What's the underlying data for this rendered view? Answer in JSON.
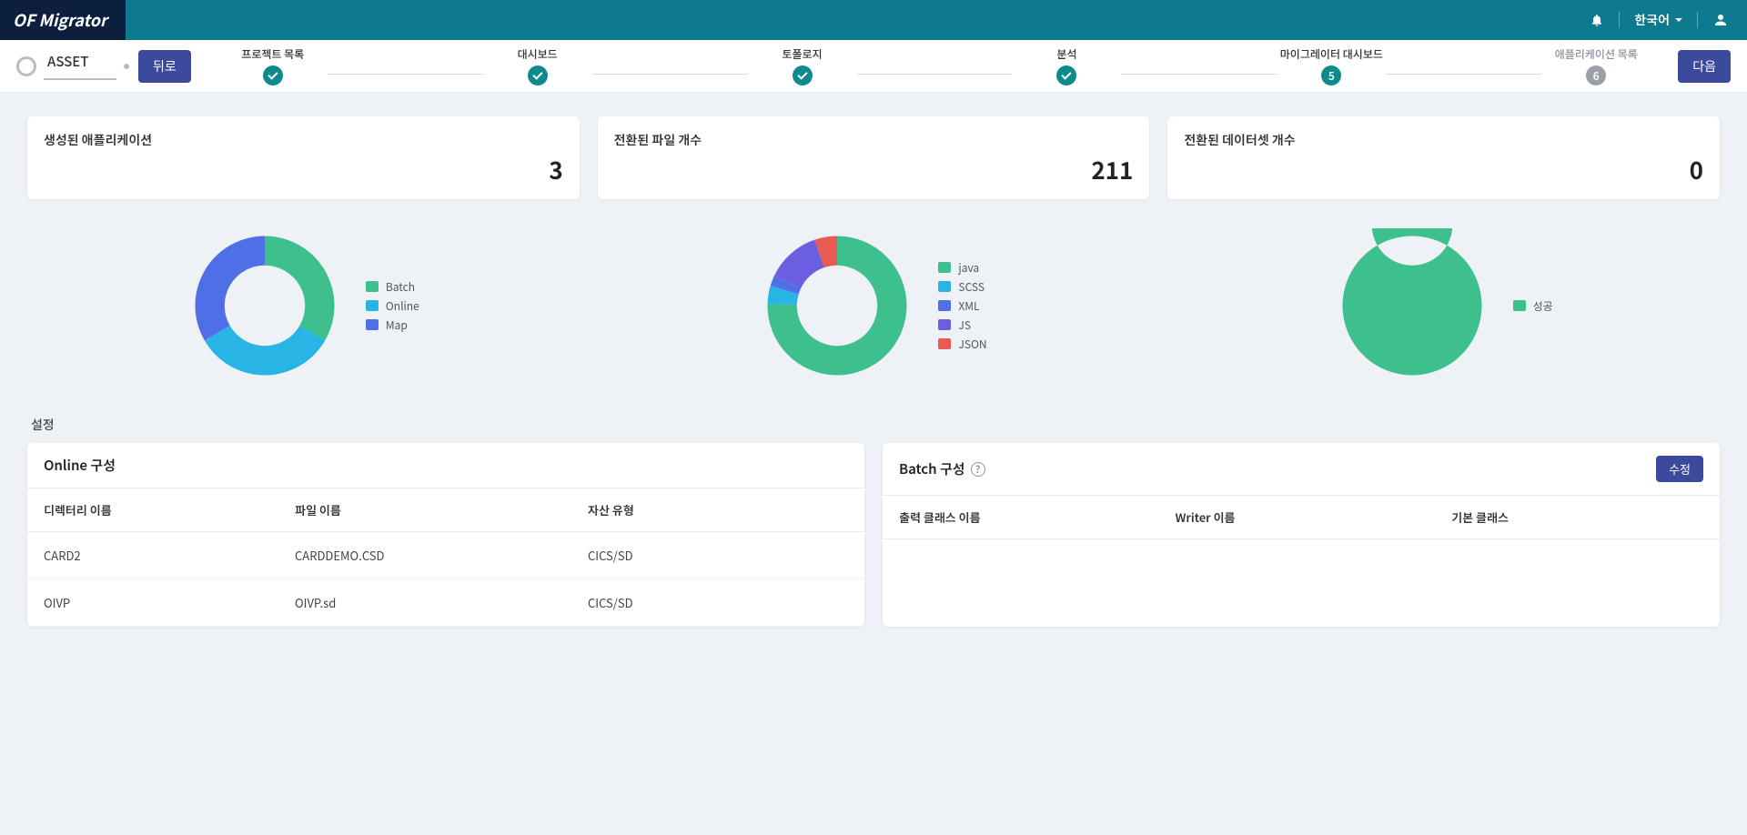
{
  "brand": "OF Migrator",
  "header": {
    "language": "한국어"
  },
  "subheader": {
    "asset_label": "ASSET",
    "back_label": "뒤로",
    "next_label": "다음"
  },
  "stepper": {
    "steps": [
      {
        "label": "프로젝트 목록",
        "state": "done"
      },
      {
        "label": "대시보드",
        "state": "done"
      },
      {
        "label": "토폴로지",
        "state": "done"
      },
      {
        "label": "분석",
        "state": "done"
      },
      {
        "label": "마이그레이터 대시보드",
        "state": "current",
        "num": "5"
      },
      {
        "label": "애플리케이션 목록",
        "state": "pending",
        "num": "6"
      }
    ]
  },
  "stats": {
    "apps": {
      "title": "생성된 애플리케이션",
      "value": "3"
    },
    "files": {
      "title": "전환된 파일 개수",
      "value": "211"
    },
    "datasets": {
      "title": "전환된 데이터셋 개수",
      "value": "0"
    }
  },
  "chart_data": [
    {
      "type": "pie",
      "title": "생성된 애플리케이션",
      "series": [
        {
          "name": "Batch",
          "value": 1,
          "color": "#3dbf8e"
        },
        {
          "name": "Online",
          "value": 1,
          "color": "#29b4e6"
        },
        {
          "name": "Map",
          "value": 1,
          "color": "#4f6fe6"
        }
      ]
    },
    {
      "type": "pie",
      "title": "전환된 파일 개수",
      "series": [
        {
          "name": "java",
          "value": 159,
          "color": "#3dbf8e"
        },
        {
          "name": "SCSS",
          "value": 9,
          "color": "#29b4e6"
        },
        {
          "name": "XML",
          "value": 5,
          "color": "#4f6fe6"
        },
        {
          "name": "JS",
          "value": 27,
          "color": "#6a5fe0"
        },
        {
          "name": "JSON",
          "value": 11,
          "color": "#ea5a55"
        }
      ]
    },
    {
      "type": "pie",
      "title": "전환된 데이터셋 개수",
      "series": [
        {
          "name": "성공",
          "value": 1,
          "color": "#3dbf8e"
        }
      ]
    }
  ],
  "settings_label": "설정",
  "online_panel": {
    "title": "Online 구성",
    "headers": {
      "dir": "디렉터리 이름",
      "file": "파일 이름",
      "asset_type": "자산 유형"
    },
    "rows": [
      {
        "dir": "CARD2",
        "file": "CARDDEMO.CSD",
        "asset_type": "CICS/SD"
      },
      {
        "dir": "OIVP",
        "file": "OIVP.sd",
        "asset_type": "CICS/SD"
      }
    ]
  },
  "batch_panel": {
    "title": "Batch 구성",
    "edit_label": "수정",
    "headers": {
      "out_class": "출력 클래스 이름",
      "writer": "Writer 이름",
      "base_class": "기본 클래스"
    }
  },
  "icons": {
    "bell": "bell-icon",
    "user": "user-icon"
  }
}
